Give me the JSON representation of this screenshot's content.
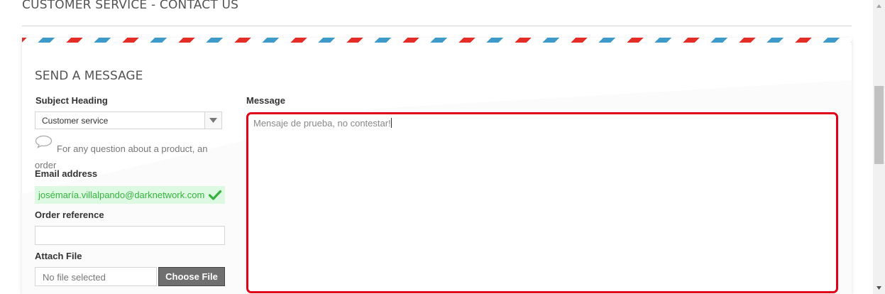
{
  "page": {
    "heading": "CUSTOMER SERVICE - CONTACT US"
  },
  "form": {
    "section_title": "SEND A MESSAGE",
    "subject": {
      "label": "Subject Heading",
      "selected": "Customer service",
      "hint": "For any question about a product, an order"
    },
    "email": {
      "label": "Email address",
      "value": "josémaría.villalpando@darknetwork.com",
      "status": "valid"
    },
    "order_reference": {
      "label": "Order reference",
      "value": ""
    },
    "attach_file": {
      "label": "Attach File",
      "file_name": "No file selected",
      "button_label": "Choose File"
    },
    "message": {
      "label": "Message",
      "value": "Mensaje de prueba, no contestar!",
      "state": "error"
    }
  },
  "colors": {
    "stripe_red": "#e52d27",
    "stripe_blue": "#3e9bc9",
    "valid_green": "#35b33f",
    "valid_bg": "#ddf9e1",
    "error_red": "#e0001a",
    "button_gray": "#6f6f6f"
  },
  "icons": {
    "select_arrow": "chevron-down-icon",
    "hint": "speech-bubble-icon",
    "valid": "checkmark-icon"
  }
}
